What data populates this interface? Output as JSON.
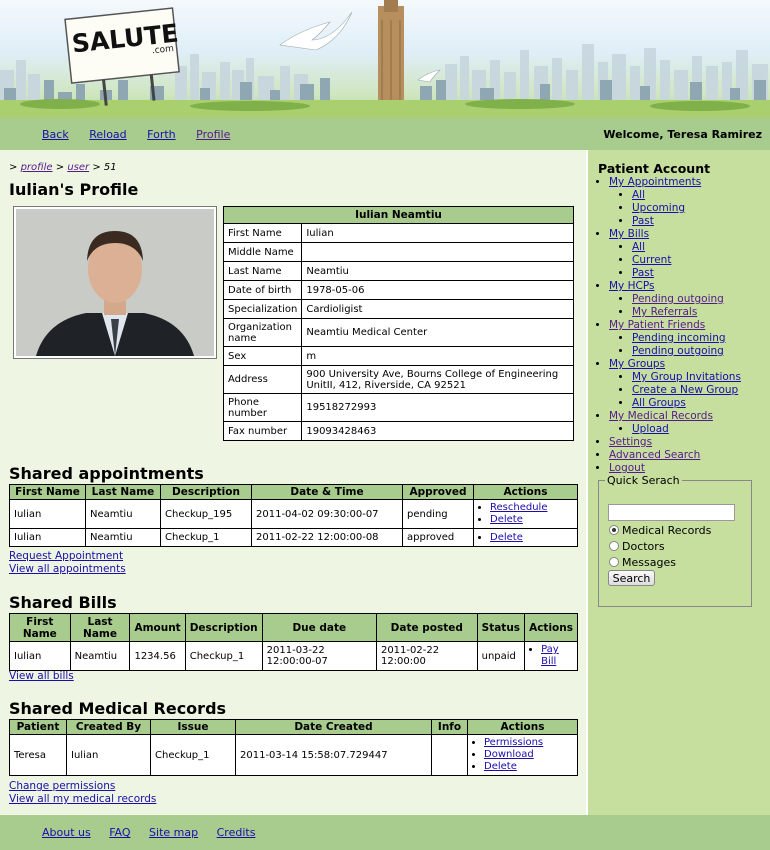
{
  "banner": {
    "logo_text": "SALUTE",
    "logo_sub": ".com"
  },
  "topnav": {
    "links": [
      "Back",
      "Reload",
      "Forth",
      "Profile"
    ],
    "welcome": "Welcome, Teresa Ramirez"
  },
  "breadcrumb": {
    "prefix": ">",
    "profile": "profile",
    "sep1": ">",
    "user": "user",
    "sep2": ">",
    "id": "51"
  },
  "page_title": "Iulian's Profile",
  "profile": {
    "header": "Iulian Neamtiu",
    "rows": [
      {
        "label": "First Name",
        "value": "Iulian"
      },
      {
        "label": "Middle Name",
        "value": ""
      },
      {
        "label": "Last Name",
        "value": "Neamtiu"
      },
      {
        "label": "Date of birth",
        "value": "1978-05-06"
      },
      {
        "label": "Specialization",
        "value": "Cardioligist"
      },
      {
        "label": "Organization name",
        "value": "Neamtiu Medical Center"
      },
      {
        "label": "Sex",
        "value": "m"
      },
      {
        "label": "Address",
        "value": "900 University Ave, Bourns College of Engineering UnitII, 412, Riverside, CA 92521"
      },
      {
        "label": "Phone number",
        "value": "19518272993"
      },
      {
        "label": "Fax number",
        "value": "19093428463"
      }
    ]
  },
  "appointments": {
    "title": "Shared appointments",
    "headers": [
      "First Name",
      "Last Name",
      "Description",
      "Date & Time",
      "Approved",
      "Actions"
    ],
    "rows": [
      {
        "first": "Iulian",
        "last": "Neamtiu",
        "desc": "Checkup_195",
        "datetime": "2011-04-02 09:30:00-07",
        "approved": "pending",
        "actions": [
          "Reschedule",
          "Delete"
        ]
      },
      {
        "first": "Iulian",
        "last": "Neamtiu",
        "desc": "Checkup_1",
        "datetime": "2011-02-22 12:00:00-08",
        "approved": "approved",
        "actions": [
          "Delete"
        ]
      }
    ],
    "links": [
      "Request Appointment",
      "View all appointments"
    ]
  },
  "bills": {
    "title": "Shared Bills",
    "headers": [
      "First Name",
      "Last Name",
      "Amount",
      "Description",
      "Due date",
      "Date posted",
      "Status",
      "Actions"
    ],
    "rows": [
      {
        "first": "Iulian",
        "last": "Neamtiu",
        "amount": "1234.56",
        "desc": "Checkup_1",
        "due": "2011-03-22 12:00:00-07",
        "posted": "2011-02-22 12:00:00",
        "status": "unpaid",
        "action": "Pay Bill"
      }
    ],
    "links": [
      "View all bills"
    ]
  },
  "records": {
    "title": "Shared Medical Records",
    "headers": [
      "Patient",
      "Created By",
      "Issue",
      "Date Created",
      "Info",
      "Actions"
    ],
    "rows": [
      {
        "patient": "Teresa",
        "created_by": "Iulian",
        "issue": "Checkup_1",
        "date": "2011-03-14 15:58:07.729447",
        "info": "",
        "actions": [
          "Permissions",
          "Download",
          "Delete"
        ]
      }
    ],
    "links": [
      "Change permissions",
      "View all my medical records"
    ]
  },
  "sidebar": {
    "title": "Patient Account",
    "items": [
      {
        "label": "My Appointments",
        "sub": [
          "All",
          "Upcoming",
          "Past"
        ]
      },
      {
        "label": "My Bills",
        "sub": [
          "All",
          "Current",
          "Past"
        ]
      },
      {
        "label": "My HCPs",
        "sub": [
          "Pending outgoing",
          "My Referrals"
        ]
      },
      {
        "label": "My Patient Friends",
        "sub": [
          "Pending incoming",
          "Pending outgoing"
        ]
      },
      {
        "label": "My Groups",
        "sub": [
          "My Group Invitations",
          "Create a New Group",
          "All Groups"
        ]
      },
      {
        "label": "My Medical Records",
        "sub": [
          "Upload"
        ]
      },
      {
        "label": "Settings",
        "sub": []
      },
      {
        "label": "Advanced Search",
        "sub": []
      },
      {
        "label": "Logout",
        "sub": []
      }
    ]
  },
  "quick_search": {
    "legend": "Quick Serach",
    "input_value": "",
    "options": [
      "Medical Records",
      "Doctors",
      "Messages"
    ],
    "selected": "Medical Records",
    "button": "Search"
  },
  "footer": {
    "links": [
      "About us",
      "FAQ",
      "Site map",
      "Credits"
    ]
  }
}
